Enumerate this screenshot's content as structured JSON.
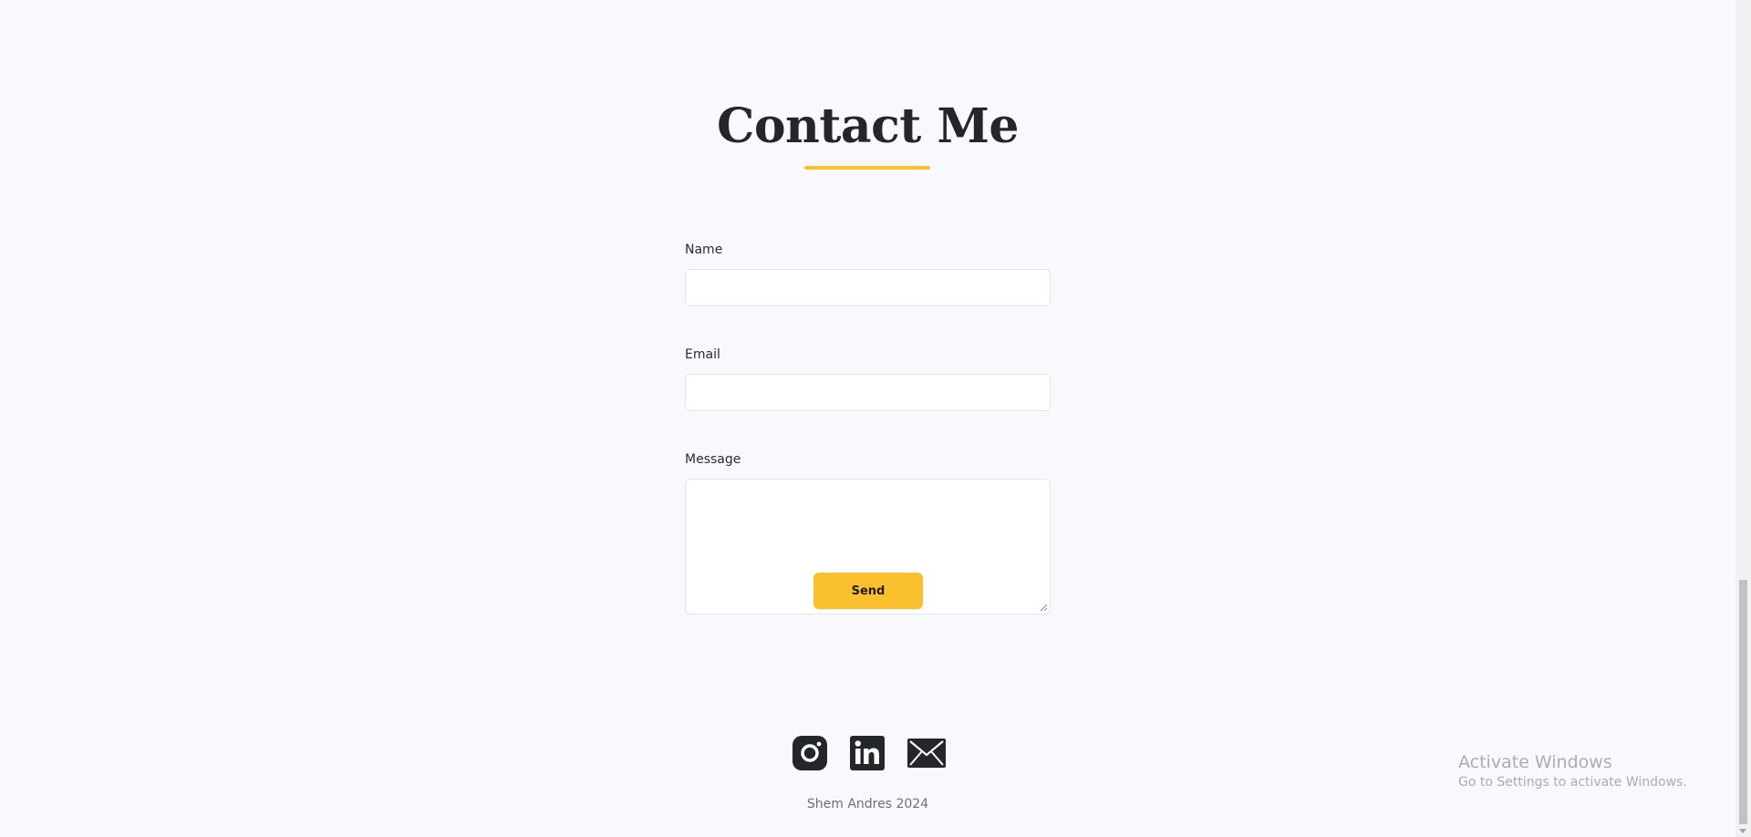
{
  "page": {
    "title": "Contact Me",
    "accent_color": "#fbc02d",
    "background_color": "#f8f9fc"
  },
  "form": {
    "name_label": "Name",
    "name_value": "",
    "email_label": "Email",
    "email_value": "",
    "message_label": "Message",
    "message_value": "",
    "send_label": "Send"
  },
  "socials": [
    {
      "name": "Instagram",
      "icon": "instagram-icon"
    },
    {
      "name": "LinkedIn",
      "icon": "linkedin-icon"
    },
    {
      "name": "Email",
      "icon": "mail-icon"
    }
  ],
  "footer": {
    "text": "Shem Andres 2024"
  },
  "watermark": {
    "title": "Activate Windows",
    "subtitle": "Go to Settings to activate Windows."
  }
}
